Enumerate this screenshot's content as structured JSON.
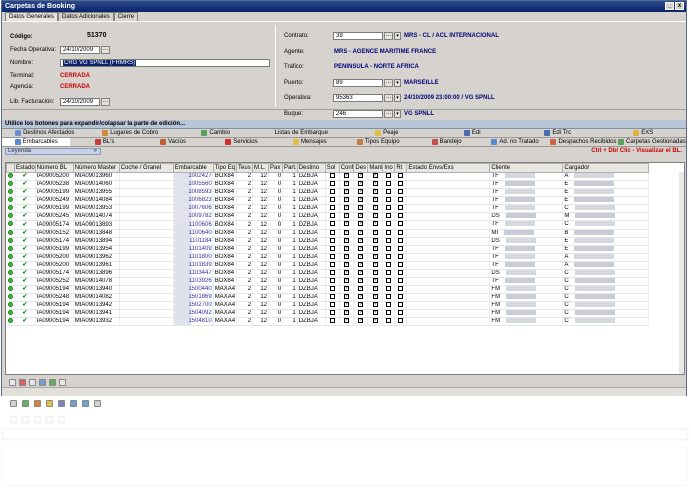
{
  "window": {
    "title": "Carpetas de Booking",
    "min": "_",
    "close": "x"
  },
  "top_tabs": [
    "Datos Generales",
    "Datos Adicionales",
    "Cierre"
  ],
  "form": {
    "codigo_label": "Código:",
    "codigo": "51370",
    "fecha_label": "Fecha Operativa:",
    "fecha": "24/10/2009",
    "nombre_label": "Nombre:",
    "nombre": "CRG VG SPNLL (FRMRS)",
    "terminal_label": "Terminal:",
    "terminal": "CERRADA",
    "agencia_label": "Agencia:",
    "agencia": "CERRADA",
    "lib_label": "Lib. Facturación:",
    "lib": "24/10/2009",
    "contrato_label": "Contrato:",
    "contrato": "39",
    "contrato_desc": "MRS - CL / ACL INTERNACIONAL",
    "agente_label": "Agente:",
    "agente": "MRS - AGENCE MARITIME FRANCE",
    "trafico_label": "Tráfico:",
    "trafico": "PENINSULA - NORTE AFRICA",
    "puerto_label": "Puerto:",
    "puerto": "89",
    "puerto_desc": "MARSEILLE",
    "operativa_label": "Operativa:",
    "operativa": "95363",
    "operativa_desc": "24/10/2009 23:00:00 / VG SPNLL",
    "buque_label": "Buque:",
    "buque": "246",
    "buque_desc": "VG SPNLL"
  },
  "panel_bar": "Utilice los botones para expandir/colapsar la parte de edición...",
  "tabs_row1": [
    "Destinos Afectados",
    "Lugares de Cobro",
    "Cambio",
    "Listas de Embarque",
    "Peaje",
    "Edi",
    "Edi Trc",
    "EXS"
  ],
  "tabs_row2": [
    "Embarcables",
    "BL's",
    "Vacíos",
    "Servicios",
    "Mensajes",
    "Tipos Equipo",
    "Bandejo",
    "Ad. no Tratado",
    "Despachos Recibidos",
    "Carpetas Gestionadas"
  ],
  "legend": "Leyenda",
  "hint": "Ctrl + Dbl Clic - Visualizar el BL.",
  "columns": [
    "",
    "Estado",
    "Número BL",
    "Número Master",
    "Coche / Granel",
    "Embarcable",
    "Tipo Eq",
    "Teus",
    "M.L.",
    "Pax",
    "Part.",
    "Destino",
    "Sol",
    "Conf",
    "Des",
    "Mani",
    "Ino",
    "Rt",
    "Estado Envs/Exs",
    "Cliente",
    "Cargador"
  ],
  "rows": [
    {
      "bl": "IA09005200",
      "master": "MIA09013960",
      "emb": "1002427",
      "tipo": "BOX84",
      "dest": "DZBJA",
      "cli": "TF",
      "car": "A"
    },
    {
      "bl": "IA09005238",
      "master": "MIA09014060",
      "emb": "1005560",
      "tipo": "BOX84",
      "dest": "DZBJA",
      "cli": "TF",
      "car": "E"
    },
    {
      "bl": "IA09005199",
      "master": "MIA09013955",
      "emb": "1008593",
      "tipo": "BOX84",
      "dest": "DZBJA",
      "cli": "TF",
      "car": "E"
    },
    {
      "bl": "IA09005249",
      "master": "MIA09014084",
      "emb": "1006823",
      "tipo": "BOX84",
      "dest": "DZBJA",
      "cli": "TF",
      "car": "E"
    },
    {
      "bl": "IA09005199",
      "master": "MIA09013953",
      "emb": "1007606",
      "tipo": "BOX84",
      "dest": "DZBJA",
      "cli": "TF",
      "car": "C"
    },
    {
      "bl": "IA09005245",
      "master": "MIA09014074",
      "emb": "1009782",
      "tipo": "BOX84",
      "dest": "DZBJA",
      "cli": "DS",
      "car": "M"
    },
    {
      "bl": "IA09005174",
      "master": "MIA09013893",
      "emb": "1100606",
      "tipo": "BOX84",
      "dest": "DZBJA",
      "cli": "TF",
      "car": "C"
    },
    {
      "bl": "IA09005152",
      "master": "MIA09013848",
      "emb": "1100640",
      "tipo": "BOX84",
      "dest": "DZBJA",
      "cli": "MI",
      "car": "B"
    },
    {
      "bl": "IA09005174",
      "master": "MIA09013894",
      "emb": "1101184",
      "tipo": "BOX84",
      "dest": "DZBJA",
      "cli": "DS",
      "car": "E"
    },
    {
      "bl": "IA09005199",
      "master": "MIA09013954",
      "emb": "1101409",
      "tipo": "BOX84",
      "dest": "DZBJA",
      "cli": "TF",
      "car": "E"
    },
    {
      "bl": "IA09005200",
      "master": "MIA09013962",
      "emb": "1101800",
      "tipo": "BOX84",
      "dest": "DZBJA",
      "cli": "TF",
      "car": "A"
    },
    {
      "bl": "IA09005200",
      "master": "MIA09013961",
      "emb": "1101839",
      "tipo": "BOX84",
      "dest": "DZBJA",
      "cli": "TF",
      "car": "A"
    },
    {
      "bl": "IA09005174",
      "master": "MIA09013896",
      "emb": "1103447",
      "tipo": "BOX84",
      "dest": "DZBJA",
      "cli": "DS",
      "car": "C"
    },
    {
      "bl": "IA09005252",
      "master": "MIA09014078",
      "emb": "1103926",
      "tipo": "BOX84",
      "dest": "DZBJA",
      "cli": "TF",
      "car": "C"
    },
    {
      "bl": "IA09005194",
      "master": "MIA09013940",
      "emb": "1500440",
      "tipo": "MAXA4",
      "dest": "DZBJA",
      "cli": "FM",
      "car": "C"
    },
    {
      "bl": "IA09005248",
      "master": "MIA09014082",
      "emb": "1501869",
      "tipo": "MAXA4",
      "dest": "DZBJA",
      "cli": "FM",
      "car": "C"
    },
    {
      "bl": "IA09005194",
      "master": "MIA09013942",
      "emb": "1502700",
      "tipo": "MAXA4",
      "dest": "DZBJA",
      "cli": "FM",
      "car": "C"
    },
    {
      "bl": "IA09005194",
      "master": "MIA09013941",
      "emb": "1504092",
      "tipo": "MAXA4",
      "dest": "DZBJA",
      "cli": "FM",
      "car": "C"
    },
    {
      "bl": "IA09005194",
      "master": "MIA09013932",
      "emb": "1504810",
      "tipo": "MAXA4",
      "dest": "DZBJA",
      "cli": "FM",
      "car": "C"
    }
  ],
  "row_defaults": {
    "teus": "2",
    "ml": "12",
    "pax": "0",
    "part": "1"
  },
  "colors": {
    "title": "#0a246a",
    "accent_red": "#cc0000",
    "navy_text": "#00007a",
    "link_blue": "#3030a0"
  }
}
